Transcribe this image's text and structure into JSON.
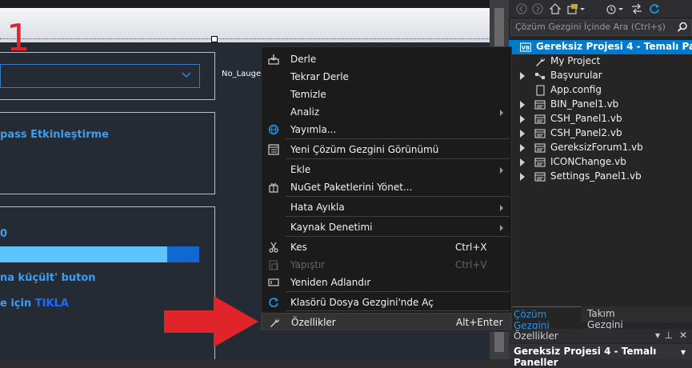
{
  "designer": {
    "big_number": "1",
    "label_no_lauge": "No_Lauge",
    "text_bypass": "pass Etkinleştirme",
    "text_zero": "0",
    "text_kucult": "na küçült' buton",
    "text_icin": "e için",
    "text_tikla": "TIKLA"
  },
  "context_menu": {
    "items": [
      {
        "label": "Derle",
        "icon": "build-icon",
        "shortcut": "",
        "submenu": false,
        "disabled": false
      },
      {
        "label": "Tekrar Derle",
        "icon": "",
        "shortcut": "",
        "submenu": false,
        "disabled": false
      },
      {
        "label": "Temizle",
        "icon": "",
        "shortcut": "",
        "submenu": false,
        "disabled": false
      },
      {
        "label": "Analiz",
        "icon": "",
        "shortcut": "",
        "submenu": true,
        "disabled": false
      },
      {
        "label": "Yayımla...",
        "icon": "globe-icon",
        "shortcut": "",
        "submenu": false,
        "disabled": false
      },
      {
        "label": "Yeni Çözüm Gezgini Görünümü",
        "icon": "new-view-icon",
        "shortcut": "",
        "submenu": false,
        "disabled": false
      },
      {
        "label": "Ekle",
        "icon": "",
        "shortcut": "",
        "submenu": true,
        "disabled": false
      },
      {
        "label": "NuGet Paketlerini Yönet...",
        "icon": "nuget-icon",
        "shortcut": "",
        "submenu": false,
        "disabled": false
      },
      {
        "label": "Hata Ayıkla",
        "icon": "",
        "shortcut": "",
        "submenu": true,
        "disabled": false
      },
      {
        "label": "Kaynak Denetimi",
        "icon": "",
        "shortcut": "",
        "submenu": true,
        "disabled": false
      },
      {
        "label": "Kes",
        "icon": "scissors-icon",
        "shortcut": "Ctrl+X",
        "submenu": false,
        "disabled": false
      },
      {
        "label": "Yapıştır",
        "icon": "paste-icon",
        "shortcut": "Ctrl+V",
        "submenu": false,
        "disabled": true
      },
      {
        "label": "Yeniden Adlandır",
        "icon": "rename-icon",
        "shortcut": "",
        "submenu": false,
        "disabled": false
      },
      {
        "label": "Klasörü Dosya Gezgini'nde Aç",
        "icon": "refresh-folder-icon",
        "shortcut": "",
        "submenu": false,
        "disabled": false
      },
      {
        "label": "Özellikler",
        "icon": "wrench-icon",
        "shortcut": "Alt+Enter",
        "submenu": false,
        "disabled": false
      }
    ]
  },
  "solution_explorer": {
    "search_placeholder": "Çözüm Gezgini İçinde Ara (Ctrl+ş)",
    "tree": [
      {
        "label": "Gereksiz Projesi 4 - Temalı Paneller",
        "icon": "vb-project-icon",
        "expander": false,
        "selected": true
      },
      {
        "label": "My Project",
        "icon": "wrench-icon",
        "expander": false,
        "selected": false
      },
      {
        "label": "Başvurular",
        "icon": "references-icon",
        "expander": true,
        "selected": false
      },
      {
        "label": "App.config",
        "icon": "config-file-icon",
        "expander": false,
        "selected": false
      },
      {
        "label": "BIN_Panel1.vb",
        "icon": "form-file-icon",
        "expander": true,
        "selected": false
      },
      {
        "label": "CSH_Panel1.vb",
        "icon": "form-file-icon",
        "expander": true,
        "selected": false
      },
      {
        "label": "CSH_Panel2.vb",
        "icon": "form-file-icon",
        "expander": true,
        "selected": false
      },
      {
        "label": "GereksizForum1.vb",
        "icon": "form-file-icon",
        "expander": true,
        "selected": false
      },
      {
        "label": "ICONChange.vb",
        "icon": "form-file-icon",
        "expander": true,
        "selected": false
      },
      {
        "label": "Settings_Panel1.vb",
        "icon": "form-file-icon",
        "expander": true,
        "selected": false
      }
    ],
    "tabs": [
      {
        "label": "Çözüm Gezgini",
        "active": true
      },
      {
        "label": "Takım Gezgini",
        "active": false
      }
    ]
  },
  "properties": {
    "title": "Özellikler",
    "object": "Gereksiz Projesi 4 - Temalı Paneller"
  },
  "colors": {
    "accent": "#007acc",
    "annotation_red": "#e0242a",
    "link_blue": "#3f9df0"
  }
}
